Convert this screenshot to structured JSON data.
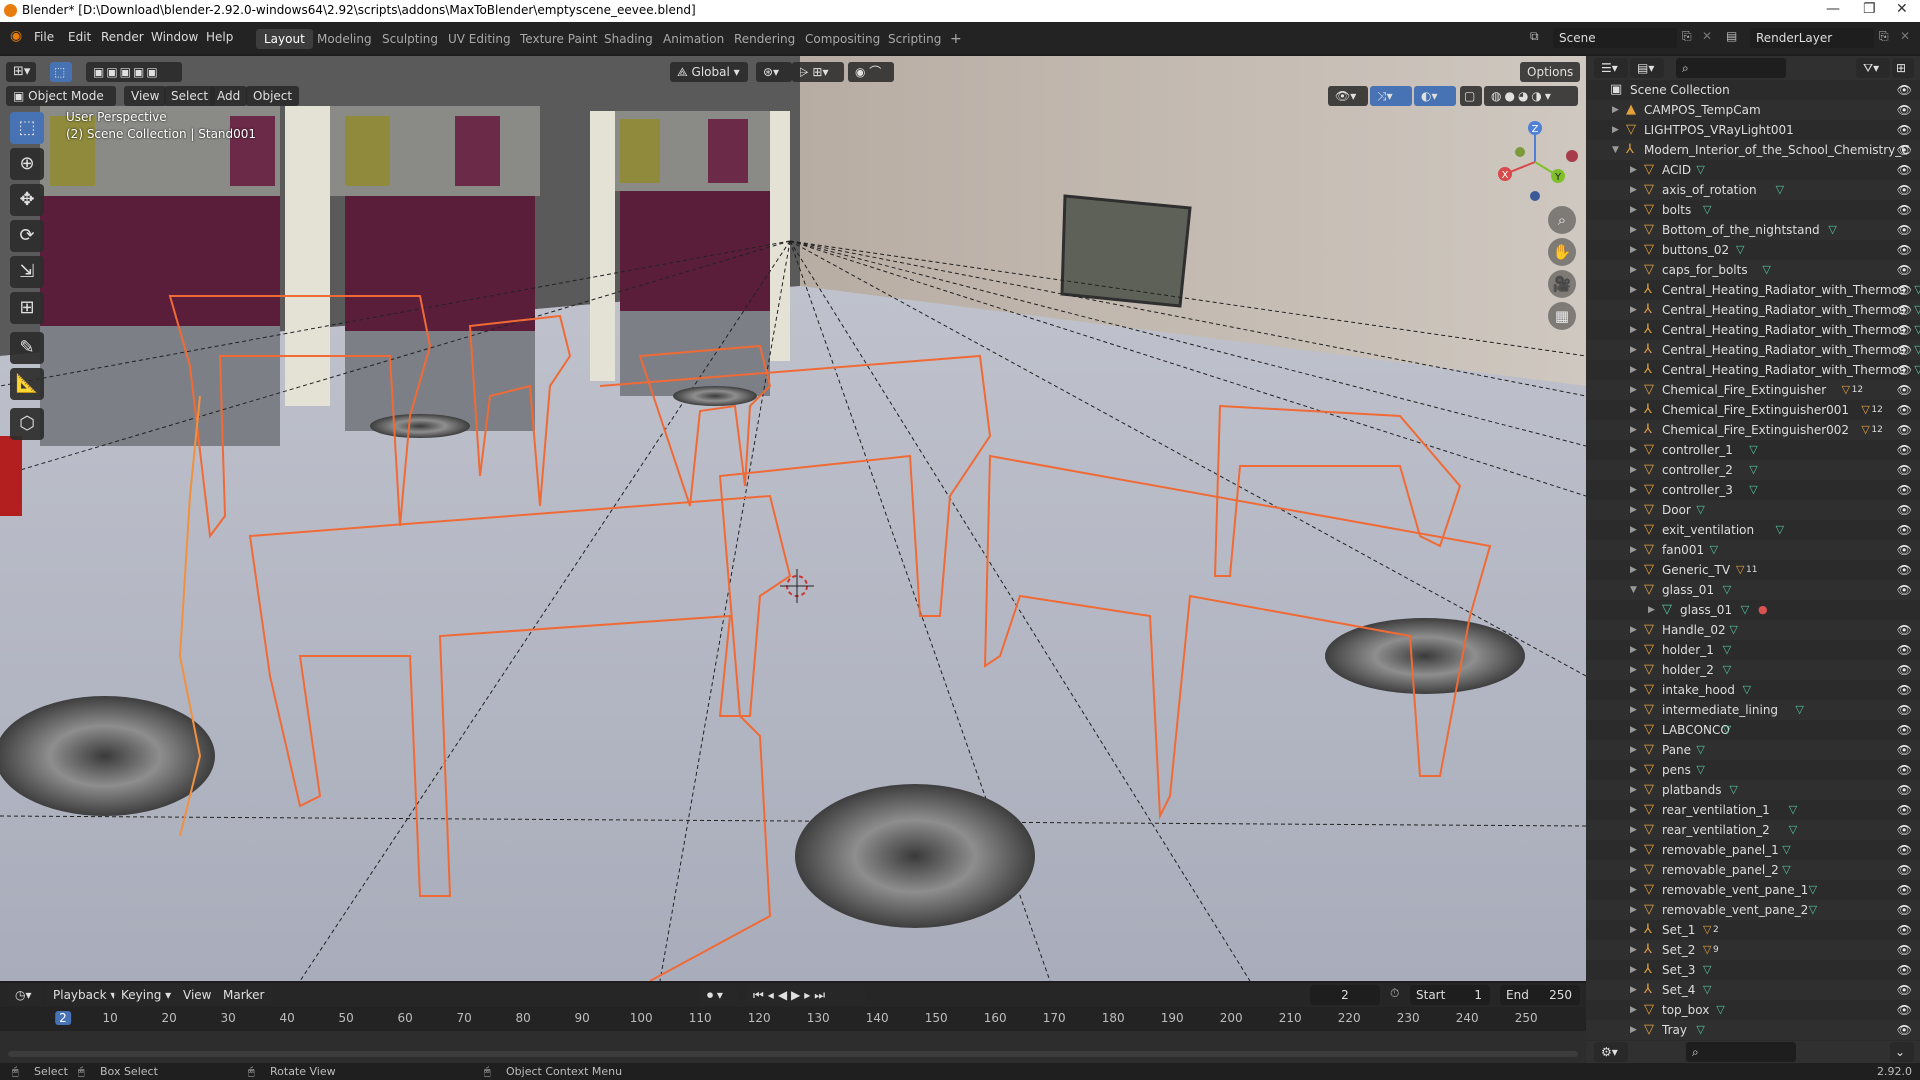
{
  "window": {
    "title": "Blender* [D:\\Download\\blender-2.92.0-windows64\\2.92\\scripts\\addons\\MaxToBlender\\emptyscene_eevee.blend]",
    "minimize": "—",
    "maximize": "❐",
    "close": "✕"
  },
  "menubar": {
    "items": [
      "File",
      "Edit",
      "Render",
      "Window",
      "Help"
    ],
    "workspaces": [
      "Layout",
      "Modeling",
      "Sculpting",
      "UV Editing",
      "Texture Paint",
      "Shading",
      "Animation",
      "Rendering",
      "Compositing",
      "Scripting"
    ],
    "active_workspace": "Layout",
    "add_workspace": "+",
    "scene": "Scene",
    "view_layer": "RenderLayer"
  },
  "viewport": {
    "mode": "Object Mode",
    "menus": [
      "View",
      "Select",
      "Add",
      "Object"
    ],
    "transform_orientation": "Global",
    "options": "Options",
    "perspective_label": "User Perspective",
    "collection_label": "(2) Scene Collection | Stand001",
    "gizmo_axes": {
      "x": "X",
      "y": "Y",
      "z": "Z"
    }
  },
  "timeline": {
    "menus": [
      "Playback",
      "Keying",
      "View",
      "Marker"
    ],
    "current_frame": "2",
    "start_label": "Start",
    "start_value": "1",
    "end_label": "End",
    "end_value": "250",
    "ruler_ticks": [
      "2",
      "10",
      "20",
      "30",
      "40",
      "50",
      "60",
      "70",
      "80",
      "90",
      "100",
      "110",
      "120",
      "130",
      "140",
      "150",
      "160",
      "170",
      "180",
      "190",
      "200",
      "210",
      "220",
      "230",
      "240",
      "250"
    ]
  },
  "statusbar": {
    "select": "Select",
    "box_select": "Box Select",
    "rotate_view": "Rotate View",
    "context_menu": "Object Context Menu",
    "version": "2.92.0"
  },
  "outliner": {
    "root": "Scene Collection",
    "rows": [
      {
        "name": "CAMPOS_TempCam",
        "level": 1,
        "expanded": false,
        "icon": "camera",
        "badge": ""
      },
      {
        "name": "LIGHTPOS_VRayLight001",
        "level": 1,
        "expanded": false,
        "icon": "light",
        "badge": ""
      },
      {
        "name": "Modern_Interior_of_the_School_Chemistry_C",
        "level": 1,
        "expanded": true,
        "icon": "empty",
        "badge": ""
      },
      {
        "name": "ACID",
        "level": 2,
        "expanded": false,
        "icon": "object",
        "badge": ""
      },
      {
        "name": "axis_of_rotation",
        "level": 2,
        "expanded": false,
        "icon": "object",
        "badge": ""
      },
      {
        "name": "bolts",
        "level": 2,
        "expanded": false,
        "icon": "object",
        "badge": ""
      },
      {
        "name": "Bottom_of_the_nightstand",
        "level": 2,
        "expanded": false,
        "icon": "object",
        "badge": ""
      },
      {
        "name": "buttons_02",
        "level": 2,
        "expanded": false,
        "icon": "object",
        "badge": ""
      },
      {
        "name": "caps_for_bolts",
        "level": 2,
        "expanded": false,
        "icon": "object",
        "badge": ""
      },
      {
        "name": "Central_Heating_Radiator_with_Thermos",
        "level": 2,
        "expanded": false,
        "icon": "empty",
        "badge": ""
      },
      {
        "name": "Central_Heating_Radiator_with_Thermos",
        "level": 2,
        "expanded": false,
        "icon": "empty",
        "badge": ""
      },
      {
        "name": "Central_Heating_Radiator_with_Thermos",
        "level": 2,
        "expanded": false,
        "icon": "empty",
        "badge": ""
      },
      {
        "name": "Central_Heating_Radiator_with_Thermos",
        "level": 2,
        "expanded": false,
        "icon": "empty",
        "badge": ""
      },
      {
        "name": "Central_Heating_Radiator_with_Thermos",
        "level": 2,
        "expanded": false,
        "icon": "empty",
        "badge": ""
      },
      {
        "name": "Chemical_Fire_Extinguisher",
        "level": 2,
        "expanded": false,
        "icon": "object",
        "badge": "12"
      },
      {
        "name": "Chemical_Fire_Extinguisher001",
        "level": 2,
        "expanded": false,
        "icon": "empty",
        "badge": "12"
      },
      {
        "name": "Chemical_Fire_Extinguisher002",
        "level": 2,
        "expanded": false,
        "icon": "empty",
        "badge": "12"
      },
      {
        "name": "controller_1",
        "level": 2,
        "expanded": false,
        "icon": "object",
        "badge": ""
      },
      {
        "name": "controller_2",
        "level": 2,
        "expanded": false,
        "icon": "object",
        "badge": ""
      },
      {
        "name": "controller_3",
        "level": 2,
        "expanded": false,
        "icon": "object",
        "badge": ""
      },
      {
        "name": "Door",
        "level": 2,
        "expanded": false,
        "icon": "object",
        "badge": ""
      },
      {
        "name": "exit_ventilation",
        "level": 2,
        "expanded": false,
        "icon": "object",
        "badge": ""
      },
      {
        "name": "fan001",
        "level": 2,
        "expanded": false,
        "icon": "object",
        "badge": ""
      },
      {
        "name": "Generic_TV",
        "level": 2,
        "expanded": false,
        "icon": "object",
        "badge": "11"
      },
      {
        "name": "glass_01",
        "level": 2,
        "expanded": true,
        "icon": "object",
        "badge": ""
      },
      {
        "name": "glass_01",
        "level": 3,
        "expanded": false,
        "icon": "mesh",
        "badge": ""
      },
      {
        "name": "Handle_02",
        "level": 2,
        "expanded": false,
        "icon": "object",
        "badge": ""
      },
      {
        "name": "holder_1",
        "level": 2,
        "expanded": false,
        "icon": "object",
        "badge": ""
      },
      {
        "name": "holder_2",
        "level": 2,
        "expanded": false,
        "icon": "object",
        "badge": ""
      },
      {
        "name": "intake_hood",
        "level": 2,
        "expanded": false,
        "icon": "object",
        "badge": ""
      },
      {
        "name": "intermediate_lining",
        "level": 2,
        "expanded": false,
        "icon": "object",
        "badge": ""
      },
      {
        "name": "LABCONCO",
        "level": 2,
        "expanded": false,
        "icon": "object",
        "badge": ""
      },
      {
        "name": "Pane",
        "level": 2,
        "expanded": false,
        "icon": "object",
        "badge": ""
      },
      {
        "name": "pens",
        "level": 2,
        "expanded": false,
        "icon": "object",
        "badge": ""
      },
      {
        "name": "platbands",
        "level": 2,
        "expanded": false,
        "icon": "object",
        "badge": ""
      },
      {
        "name": "rear_ventilation_1",
        "level": 2,
        "expanded": false,
        "icon": "object",
        "badge": ""
      },
      {
        "name": "rear_ventilation_2",
        "level": 2,
        "expanded": false,
        "icon": "object",
        "badge": ""
      },
      {
        "name": "removable_panel_1",
        "level": 2,
        "expanded": false,
        "icon": "object",
        "badge": ""
      },
      {
        "name": "removable_panel_2",
        "level": 2,
        "expanded": false,
        "icon": "object",
        "badge": ""
      },
      {
        "name": "removable_vent_pane_1",
        "level": 2,
        "expanded": false,
        "icon": "object",
        "badge": ""
      },
      {
        "name": "removable_vent_pane_2",
        "level": 2,
        "expanded": false,
        "icon": "object",
        "badge": ""
      },
      {
        "name": "Set_1",
        "level": 2,
        "expanded": false,
        "icon": "empty",
        "badge": "2"
      },
      {
        "name": "Set_2",
        "level": 2,
        "expanded": false,
        "icon": "empty",
        "badge": "9"
      },
      {
        "name": "Set_3",
        "level": 2,
        "expanded": false,
        "icon": "empty",
        "badge": ""
      },
      {
        "name": "Set_4",
        "level": 2,
        "expanded": false,
        "icon": "empty",
        "badge": ""
      },
      {
        "name": "top_box",
        "level": 2,
        "expanded": false,
        "icon": "object",
        "badge": ""
      },
      {
        "name": "Tray",
        "level": 2,
        "expanded": false,
        "icon": "object",
        "badge": ""
      }
    ]
  },
  "colors": {
    "accent": "#4772b3",
    "selection_outline": "#f06a36",
    "object_icon": "#e2a03c",
    "mesh_icon": "#54c4a0",
    "panel_bg": "#2b2b2b"
  }
}
